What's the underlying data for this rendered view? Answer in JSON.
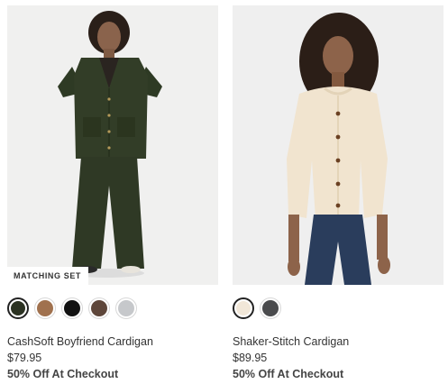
{
  "products": [
    {
      "badge": "MATCHING SET",
      "swatches": [
        {
          "icon": "swatch-dark-olive",
          "color": "#2b3222",
          "selected": true
        },
        {
          "icon": "swatch-camel",
          "color": "#a0714e",
          "selected": false
        },
        {
          "icon": "swatch-black",
          "color": "#111111",
          "selected": false
        },
        {
          "icon": "swatch-brown",
          "color": "#5e463a",
          "selected": false
        },
        {
          "icon": "swatch-light-grey",
          "color": "#c6c8cb",
          "selected": false
        }
      ],
      "name": "CashSoft Boyfriend Cardigan",
      "price": "$79.95",
      "promo": "50% Off At Checkout"
    },
    {
      "badge": "",
      "swatches": [
        {
          "icon": "swatch-ivory",
          "color": "#f1e7d8",
          "selected": true
        },
        {
          "icon": "swatch-charcoal",
          "color": "#4a4b4d",
          "selected": false
        }
      ],
      "name": "Shaker-Stitch Cardigan",
      "price": "$89.95",
      "promo": "50% Off At Checkout"
    }
  ]
}
